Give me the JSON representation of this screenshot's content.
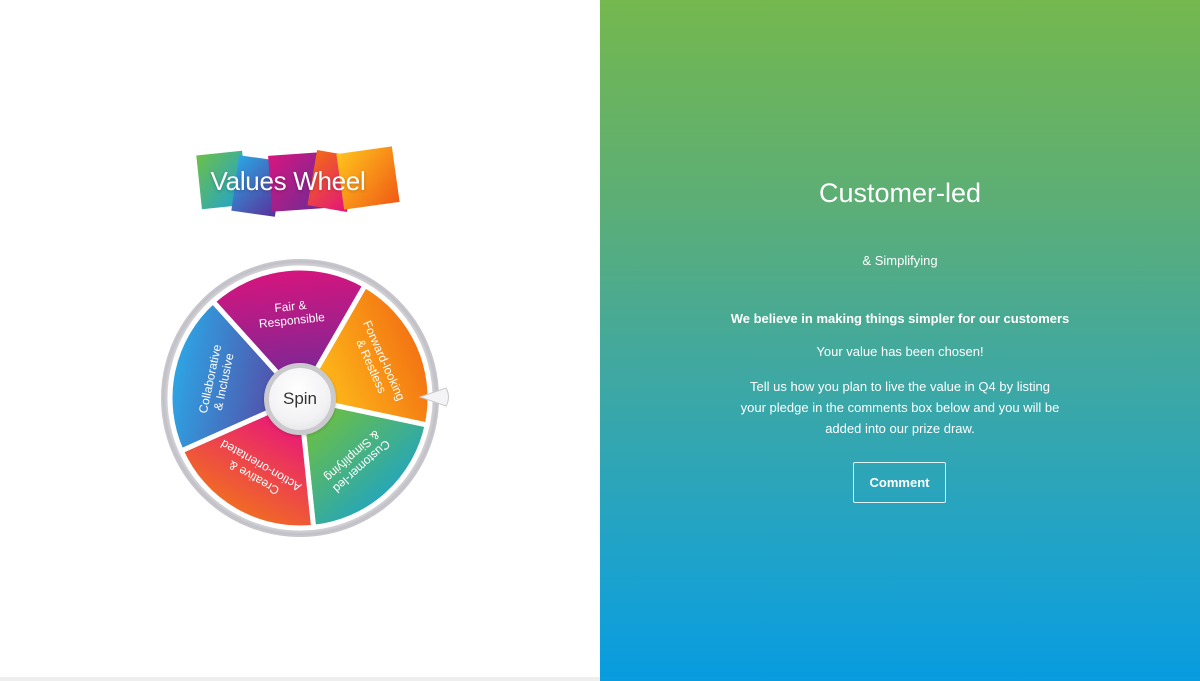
{
  "logo": {
    "text": "Values Wheel"
  },
  "wheel": {
    "spin_label": "Spin",
    "segments": [
      {
        "lines": [
          "Forward-looking",
          "& Restless"
        ],
        "color_start": "#ffc21a",
        "color_end": "#f26b12"
      },
      {
        "lines": [
          "Customer-led",
          "& Simplifying"
        ],
        "color_start": "#6bbf45",
        "color_end": "#16a0d3"
      },
      {
        "lines": [
          "Creative &",
          "Action-orientated"
        ],
        "color_start": "#e8127f",
        "color_end": "#f27a14"
      },
      {
        "lines": [
          "Collaborative",
          "& Inclusive"
        ],
        "color_start": "#5a3f9e",
        "color_end": "#2ca8e6"
      },
      {
        "lines": [
          "Fair &",
          "Responsible"
        ],
        "color_start": "#6a2b9a",
        "color_end": "#d8147d"
      }
    ],
    "selected": "Customer-led"
  },
  "result": {
    "title": "Customer-led",
    "subtitle": "& Simplifying",
    "belief": "We believe in making things simpler for our customers",
    "chosen": "Your value has been chosen!",
    "instructions": "Tell us how you plan to live the value in Q4 by listing your pledge in the comments box below and you will be added into our prize draw.",
    "button_label": "Comment"
  },
  "colors": {
    "gradient_top": "#74b84e",
    "gradient_bottom": "#079ce0"
  }
}
